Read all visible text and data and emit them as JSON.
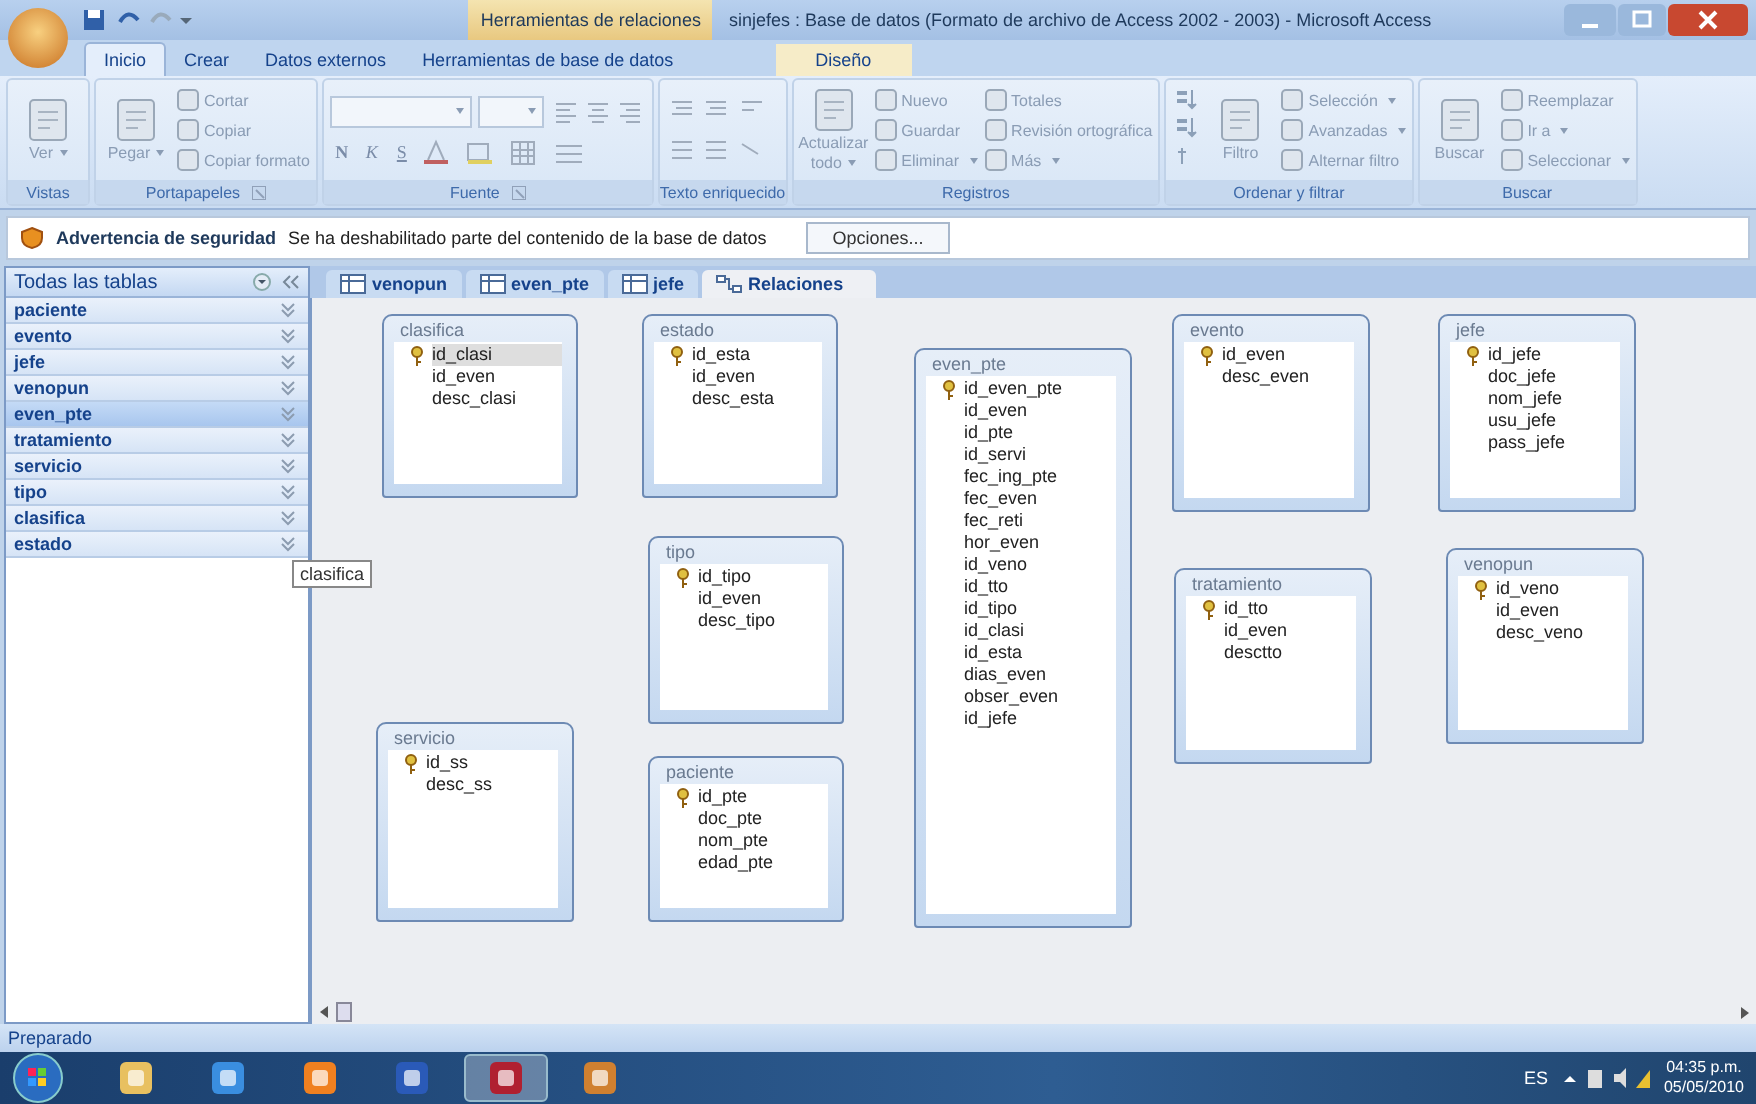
{
  "window": {
    "context_tab": "Herramientas de relaciones",
    "title": "sinjefes : Base de datos (Formato de archivo de Access 2002 - 2003) - Microsoft Access"
  },
  "ribbon_tabs": [
    {
      "label": "Inicio",
      "selected": true,
      "contextual": false
    },
    {
      "label": "Crear",
      "selected": false,
      "contextual": false
    },
    {
      "label": "Datos externos",
      "selected": false,
      "contextual": false
    },
    {
      "label": "Herramientas de base de datos",
      "selected": false,
      "contextual": false
    },
    {
      "label": "Diseño",
      "selected": false,
      "contextual": true
    }
  ],
  "ribbon_groups": [
    {
      "label": "Vistas",
      "launcher": false,
      "items": [
        {
          "kind": "large",
          "label": "Ver",
          "disabled": true,
          "dropdown": true
        }
      ]
    },
    {
      "label": "Portapapeles",
      "launcher": true,
      "items": [
        {
          "kind": "large",
          "label": "Pegar",
          "disabled": true,
          "dropdown": true
        },
        {
          "kind": "stack",
          "entries": [
            {
              "label": "Cortar",
              "disabled": true,
              "dropdown": false
            },
            {
              "label": "Copiar",
              "disabled": true,
              "dropdown": false
            },
            {
              "label": "Copiar formato",
              "disabled": true,
              "dropdown": false
            }
          ]
        }
      ]
    },
    {
      "label": "Fuente",
      "launcher": true,
      "items": [
        {
          "kind": "font",
          "styles": [
            "N",
            "K",
            "S"
          ]
        }
      ]
    },
    {
      "label": "Texto enriquecido",
      "launcher": false,
      "items": [
        {
          "kind": "rich"
        }
      ]
    },
    {
      "label": "Registros",
      "launcher": false,
      "items": [
        {
          "kind": "large",
          "label": "Actualizar todo",
          "disabled": true,
          "dropdown": true
        },
        {
          "kind": "stack",
          "entries": [
            {
              "label": "Nuevo",
              "disabled": true,
              "dropdown": false
            },
            {
              "label": "Guardar",
              "disabled": true,
              "dropdown": false
            },
            {
              "label": "Eliminar",
              "disabled": true,
              "dropdown": true
            }
          ]
        },
        {
          "kind": "stack",
          "entries": [
            {
              "label": "Totales",
              "disabled": true,
              "dropdown": false
            },
            {
              "label": "Revisión ortográfica",
              "disabled": true,
              "dropdown": false
            },
            {
              "label": "Más",
              "disabled": true,
              "dropdown": true
            }
          ]
        }
      ]
    },
    {
      "label": "Ordenar y filtrar",
      "launcher": false,
      "items": [
        {
          "kind": "sort"
        },
        {
          "kind": "large",
          "label": "Filtro",
          "disabled": true,
          "dropdown": false
        },
        {
          "kind": "stack",
          "entries": [
            {
              "label": "Selección",
              "disabled": true,
              "dropdown": true
            },
            {
              "label": "Avanzadas",
              "disabled": true,
              "dropdown": true
            },
            {
              "label": "Alternar filtro",
              "disabled": true,
              "dropdown": false
            }
          ]
        }
      ]
    },
    {
      "label": "Buscar",
      "launcher": false,
      "items": [
        {
          "kind": "large",
          "label": "Buscar",
          "disabled": true,
          "dropdown": false
        },
        {
          "kind": "stack",
          "entries": [
            {
              "label": "Reemplazar",
              "disabled": true,
              "dropdown": false
            },
            {
              "label": "Ir a",
              "disabled": true,
              "dropdown": true
            },
            {
              "label": "Seleccionar",
              "disabled": true,
              "dropdown": true
            }
          ]
        }
      ]
    }
  ],
  "security_bar": {
    "title": "Advertencia de seguridad",
    "message": "Se ha deshabilitado parte del contenido de la base de datos",
    "button": "Opciones..."
  },
  "nav_pane": {
    "title": "Todas las tablas",
    "items": [
      {
        "label": "paciente",
        "selected": false
      },
      {
        "label": "evento",
        "selected": false
      },
      {
        "label": "jefe",
        "selected": false
      },
      {
        "label": "venopun",
        "selected": false
      },
      {
        "label": "even_pte",
        "selected": true
      },
      {
        "label": "tratamiento",
        "selected": false
      },
      {
        "label": "servicio",
        "selected": false
      },
      {
        "label": "tipo",
        "selected": false
      },
      {
        "label": "clasifica",
        "selected": false
      },
      {
        "label": "estado",
        "selected": false
      }
    ],
    "tooltip": "clasifica"
  },
  "doc_tabs": [
    {
      "label": "venopun",
      "kind": "table",
      "selected": false
    },
    {
      "label": "even_pte",
      "kind": "table",
      "selected": false
    },
    {
      "label": "jefe",
      "kind": "table",
      "selected": false
    },
    {
      "label": "Relaciones",
      "kind": "relations",
      "selected": true
    }
  ],
  "tables": [
    {
      "name": "clasifica",
      "fields": [
        {
          "name": "id_clasi",
          "key": true,
          "selected": true
        },
        {
          "name": "id_even",
          "key": false,
          "selected": false
        },
        {
          "name": "desc_clasi",
          "key": false,
          "selected": false
        }
      ]
    },
    {
      "name": "estado",
      "fields": [
        {
          "name": "id_esta",
          "key": true,
          "selected": false
        },
        {
          "name": "id_even",
          "key": false,
          "selected": false
        },
        {
          "name": "desc_esta",
          "key": false,
          "selected": false
        }
      ]
    },
    {
      "name": "tipo",
      "fields": [
        {
          "name": "id_tipo",
          "key": true,
          "selected": false
        },
        {
          "name": "id_even",
          "key": false,
          "selected": false
        },
        {
          "name": "desc_tipo",
          "key": false,
          "selected": false
        }
      ]
    },
    {
      "name": "servicio",
      "fields": [
        {
          "name": "id_ss",
          "key": true,
          "selected": false
        },
        {
          "name": "desc_ss",
          "key": false,
          "selected": false
        }
      ]
    },
    {
      "name": "paciente",
      "fields": [
        {
          "name": "id_pte",
          "key": true,
          "selected": false
        },
        {
          "name": "doc_pte",
          "key": false,
          "selected": false
        },
        {
          "name": "nom_pte",
          "key": false,
          "selected": false
        },
        {
          "name": "edad_pte",
          "key": false,
          "selected": false
        }
      ]
    },
    {
      "name": "even_pte",
      "fields": [
        {
          "name": "id_even_pte",
          "key": true,
          "selected": false
        },
        {
          "name": "id_even",
          "key": false,
          "selected": false
        },
        {
          "name": "id_pte",
          "key": false,
          "selected": false
        },
        {
          "name": "id_servi",
          "key": false,
          "selected": false
        },
        {
          "name": "fec_ing_pte",
          "key": false,
          "selected": false
        },
        {
          "name": "fec_even",
          "key": false,
          "selected": false
        },
        {
          "name": "fec_reti",
          "key": false,
          "selected": false
        },
        {
          "name": "hor_even",
          "key": false,
          "selected": false
        },
        {
          "name": "id_veno",
          "key": false,
          "selected": false
        },
        {
          "name": "id_tto",
          "key": false,
          "selected": false
        },
        {
          "name": "id_tipo",
          "key": false,
          "selected": false
        },
        {
          "name": "id_clasi",
          "key": false,
          "selected": false
        },
        {
          "name": "id_esta",
          "key": false,
          "selected": false
        },
        {
          "name": "dias_even",
          "key": false,
          "selected": false
        },
        {
          "name": "obser_even",
          "key": false,
          "selected": false
        },
        {
          "name": "id_jefe",
          "key": false,
          "selected": false
        }
      ]
    },
    {
      "name": "evento",
      "fields": [
        {
          "name": "id_even",
          "key": true,
          "selected": false
        },
        {
          "name": "desc_even",
          "key": false,
          "selected": false
        }
      ]
    },
    {
      "name": "jefe",
      "fields": [
        {
          "name": "id_jefe",
          "key": true,
          "selected": false
        },
        {
          "name": "doc_jefe",
          "key": false,
          "selected": false
        },
        {
          "name": "nom_jefe",
          "key": false,
          "selected": false
        },
        {
          "name": "usu_jefe",
          "key": false,
          "selected": false
        },
        {
          "name": "pass_jefe",
          "key": false,
          "selected": false
        }
      ]
    },
    {
      "name": "tratamiento",
      "fields": [
        {
          "name": "id_tto",
          "key": true,
          "selected": false
        },
        {
          "name": "id_even",
          "key": false,
          "selected": false
        },
        {
          "name": "desctto",
          "key": false,
          "selected": false
        }
      ]
    },
    {
      "name": "venopun",
      "fields": [
        {
          "name": "id_veno",
          "key": true,
          "selected": false
        },
        {
          "name": "id_even",
          "key": false,
          "selected": false
        },
        {
          "name": "desc_veno",
          "key": false,
          "selected": false
        }
      ]
    }
  ],
  "status_bar": {
    "text": "Preparado"
  },
  "taskbar": {
    "apps": [
      {
        "kind": "folder",
        "active": false
      },
      {
        "kind": "browser",
        "active": false
      },
      {
        "kind": "media",
        "active": false
      },
      {
        "kind": "word",
        "active": false
      },
      {
        "kind": "access",
        "active": true
      },
      {
        "kind": "other",
        "active": false
      }
    ],
    "language": "ES",
    "time": "04:35 p.m.",
    "date": "05/05/2010"
  }
}
